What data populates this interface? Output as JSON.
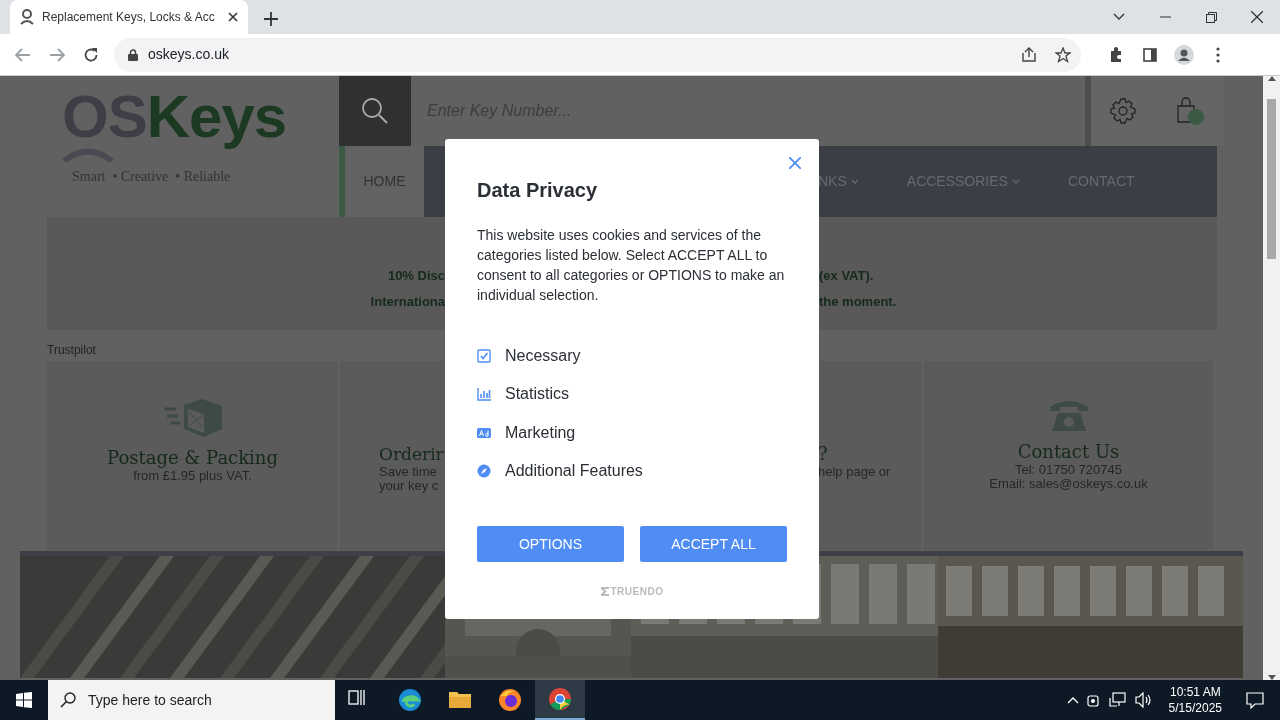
{
  "browser": {
    "tab_title": "Replacement Keys, Locks & Acc",
    "url": "oskeys.co.uk"
  },
  "site": {
    "logo": {
      "part_1": "OS",
      "part_2": "Keys",
      "tagline": "Smart  • Creative  • Reliable"
    },
    "search": {
      "placeholder": "Enter Key Number..."
    },
    "nav": [
      {
        "label": "HOME",
        "selected": true,
        "dropdown": false
      },
      {
        "label": "NKS",
        "selected": false,
        "dropdown": true
      },
      {
        "label": "ACCESSORIES",
        "selected": false,
        "dropdown": true
      },
      {
        "label": "CONTACT",
        "selected": false,
        "dropdown": false
      }
    ],
    "banner": {
      "left_lines": [
        "10% Disc",
        "Internationa"
      ],
      "right_lines": [
        "(ex VAT).",
        "the moment."
      ]
    },
    "trustpilot": "Trustpilot",
    "features": [
      {
        "kind": "postage",
        "title": "Postage & Packing",
        "lines": [
          "from £1.95 plus VAT."
        ]
      },
      {
        "kind": "ordering",
        "title": "Orderir",
        "lines": [
          "Save time",
          "your key c"
        ]
      },
      {
        "kind": "help",
        "title": "?",
        "lines": [
          "help page or"
        ]
      },
      {
        "kind": "contact",
        "title": "Contact Us",
        "lines": [
          "Tel: 01750 720745",
          "Email: sales@oskeys.co.uk"
        ]
      }
    ]
  },
  "modal": {
    "title": "Data Privacy",
    "text": "This website uses cookies and services of the categories listed below. Select ACCEPT ALL to consent to all categories or OPTIONS to make an individual selection.",
    "categories": [
      {
        "label": "Necessary",
        "kind": "check"
      },
      {
        "label": "Statistics",
        "kind": "chart"
      },
      {
        "label": "Marketing",
        "kind": "ad"
      },
      {
        "label": "Additional Features",
        "kind": "compass"
      }
    ],
    "buttons": [
      "OPTIONS",
      "ACCEPT ALL"
    ],
    "brand": "TRUENDO"
  },
  "taskbar": {
    "search_placeholder": "Type here to search",
    "apps": [
      {
        "kind": "taskview",
        "selected": false
      },
      {
        "kind": "edge",
        "selected": false
      },
      {
        "kind": "explorer",
        "selected": false
      },
      {
        "kind": "firefox",
        "selected": false
      },
      {
        "kind": "chrome",
        "selected": true
      }
    ],
    "time": "10:51 AM",
    "date": "5/15/2025"
  }
}
